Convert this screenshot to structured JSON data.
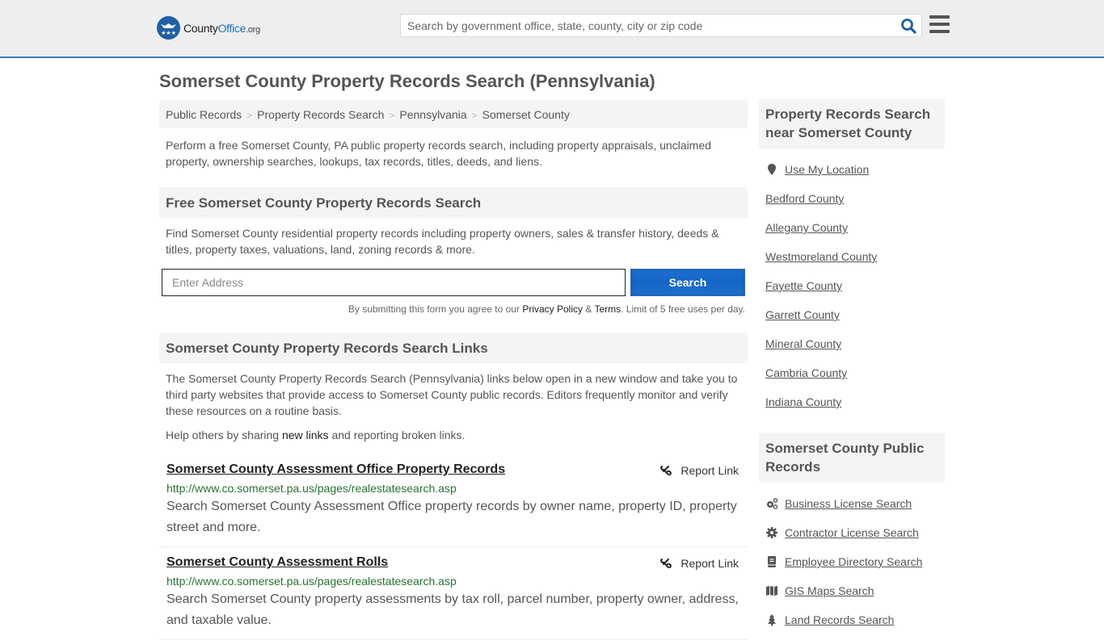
{
  "header": {
    "logo": {
      "name": "County",
      "accent": "Office",
      "tld": ".org"
    },
    "search_placeholder": "Search by government office, state, county, city or zip code"
  },
  "page_title": "Somerset County Property Records Search (Pennsylvania)",
  "breadcrumb": [
    "Public Records",
    "Property Records Search",
    "Pennsylvania",
    "Somerset County"
  ],
  "intro": "Perform a free Somerset County, PA public property records search, including property appraisals, unclaimed property, ownership searches, lookups, tax records, titles, deeds, and liens.",
  "free_search": {
    "heading": "Free Somerset County Property Records Search",
    "description": "Find Somerset County residential property records including property owners, sales & transfer history, deeds & titles, property taxes, valuations, land, zoning records & more.",
    "address_placeholder": "Enter Address",
    "search_button": "Search",
    "agree_prefix": "By submitting this form you agree to our ",
    "privacy_link": "Privacy Policy",
    "amp": " & ",
    "terms_link": "Terms",
    "agree_suffix": ". Limit of 5 free uses per day."
  },
  "links_section": {
    "heading": "Somerset County Property Records Search Links",
    "description": "The Somerset County Property Records Search (Pennsylvania) links below open in a new window and take you to third party websites that provide access to Somerset County public records. Editors frequently monitor and verify these resources on a routine basis.",
    "help_prefix": "Help others by sharing ",
    "help_link": "new links",
    "help_suffix": " and reporting broken links.",
    "report_label": "Report Link",
    "records": [
      {
        "title": "Somerset County Assessment Office Property Records",
        "url": "http://www.co.somerset.pa.us/pages/realestatesearch.asp",
        "description": "Search Somerset County Assessment Office property records by owner name, property ID, property street and more."
      },
      {
        "title": "Somerset County Assessment Rolls",
        "url": "http://www.co.somerset.pa.us/pages/realestatesearch.asp",
        "description": "Search Somerset County property assessments by tax roll, parcel number, property owner, address, and taxable value."
      }
    ]
  },
  "sidebar": {
    "nearby_heading": "Property Records Search near Somerset County",
    "use_location": "Use My Location",
    "nearby": [
      "Bedford County",
      "Allegany County",
      "Westmoreland County",
      "Fayette County",
      "Garrett County",
      "Mineral County",
      "Cambria County",
      "Indiana County"
    ],
    "public_heading": "Somerset County Public Records",
    "public_records": [
      {
        "label": "Business License Search",
        "icon": "gears-icon"
      },
      {
        "label": "Contractor License Search",
        "icon": "gear-icon"
      },
      {
        "label": "Employee Directory Search",
        "icon": "book-icon"
      },
      {
        "label": "GIS Maps Search",
        "icon": "map-icon"
      },
      {
        "label": "Land Records Search",
        "icon": "tree-icon"
      }
    ]
  },
  "colors": {
    "accent_blue": "#1f6fbf",
    "header_border": "#3a7db5",
    "url_green": "#287233",
    "button_blue": "#1565c6"
  }
}
